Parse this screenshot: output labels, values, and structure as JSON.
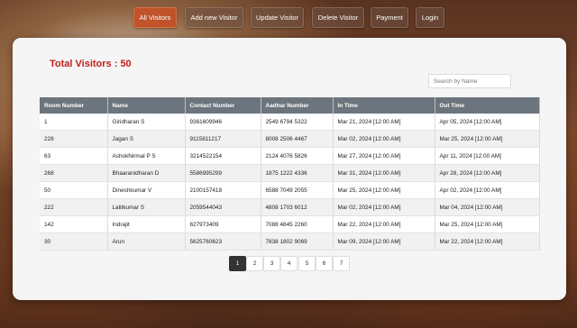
{
  "nav": {
    "items": [
      {
        "label": "All Visitors",
        "active": true
      },
      {
        "label": "Add new Visitor"
      },
      {
        "label": "Update Visitor"
      },
      {
        "label": "Delete Visitor"
      },
      {
        "label": "Payment"
      },
      {
        "label": "Login"
      }
    ]
  },
  "summary": {
    "total_label": "Total Visitors : 50"
  },
  "search": {
    "placeholder": "Search by Name"
  },
  "table": {
    "headers": [
      "Room Number",
      "Name",
      "Contact Number",
      "Aadhar Number",
      "In Time",
      "Out Time"
    ],
    "rows": [
      [
        "1",
        "Giridharan S",
        "9361609946",
        "2549 6794 5322",
        "Mar 21, 2024 [12:00 AM]",
        "Apr 05, 2024 [12:00 AM]"
      ],
      [
        "228",
        "Jagan S",
        "9115811217",
        "8008 2506 4467",
        "Mar 02, 2024 [12:00 AM]",
        "Mar 25, 2024 [12:00 AM]"
      ],
      [
        "63",
        "AshokNirmal P S",
        "3214522154",
        "2124 4076 5826",
        "Mar 27, 2024 [12:00 AM]",
        "Apr 11, 2024 [12:00 AM]"
      ],
      [
        "268",
        "Bhaaranidharan D",
        "5586995299",
        "1875 1222 4336",
        "Mar 31, 2024 [12:00 AM]",
        "Apr 28, 2024 [12:00 AM]"
      ],
      [
        "50",
        "Dineshkumar V",
        "2100157418",
        "6588 7049 2055",
        "Mar 25, 2024 [12:00 AM]",
        "Apr 02, 2024 [12:00 AM]"
      ],
      [
        "222",
        "Lalitkumar S",
        "2059544043",
        "4808 1703 6012",
        "Mar 02, 2024 [12:00 AM]",
        "Mar 04, 2024 [12:00 AM]"
      ],
      [
        "142",
        "Indrajit",
        "627973409",
        "7088 4845 2260",
        "Mar 22, 2024 [12:00 AM]",
        "Mar 25, 2024 [12:00 AM]"
      ],
      [
        "30",
        "Arun",
        "5625760623",
        "7838 1802 9069",
        "Mar 09, 2024 [12:00 AM]",
        "Mar 22, 2024 [12:00 AM]"
      ]
    ]
  },
  "pagination": {
    "pages": [
      "1",
      "2",
      "3",
      "4",
      "5",
      "6",
      "7"
    ],
    "current": "1"
  },
  "colors": {
    "accent": "#c0532a",
    "total_text": "#c0211b",
    "table_header": "#6c757d",
    "active_page": "#333333"
  }
}
